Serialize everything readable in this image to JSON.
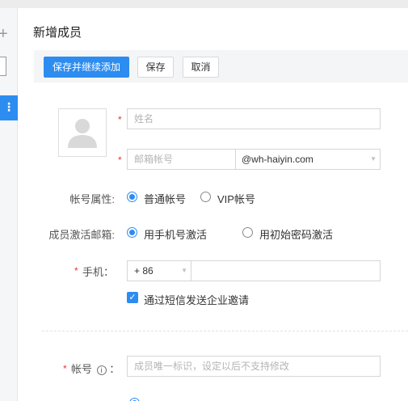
{
  "header": {
    "title": "新增成员"
  },
  "toolbar": {
    "save_and_add": "保存并继续添加",
    "save": "保存",
    "cancel": "取消"
  },
  "left_panel": {
    "plus_glyph": "+",
    "menu_glyph": "⋮"
  },
  "form": {
    "required_mark": "*",
    "name": {
      "placeholder": "姓名"
    },
    "email": {
      "placeholder": "邮箱帐号",
      "domain": "@wh-haiyin.com"
    },
    "account_type": {
      "label": "帐号属性:",
      "options": [
        "普通帐号",
        "VIP帐号"
      ],
      "selected": "普通帐号"
    },
    "activation": {
      "label": "成员激活邮箱:",
      "options": [
        "用手机号激活",
        "用初始密码激活"
      ],
      "selected": "用手机号激活"
    },
    "phone": {
      "label": "手机：",
      "country_code": "+ 86",
      "number": ""
    },
    "sms_invite": {
      "label": "通过短信发送企业邀请",
      "checked": true
    },
    "account_id": {
      "label": "帐号",
      "label_suffix": "：",
      "info_icon": "i",
      "placeholder": "成员唯一标识，设定以后不支持修改"
    }
  },
  "colors": {
    "primary": "#2d8cf0",
    "required": "#ee3333",
    "toolbar_bg": "#f4f5f7"
  }
}
